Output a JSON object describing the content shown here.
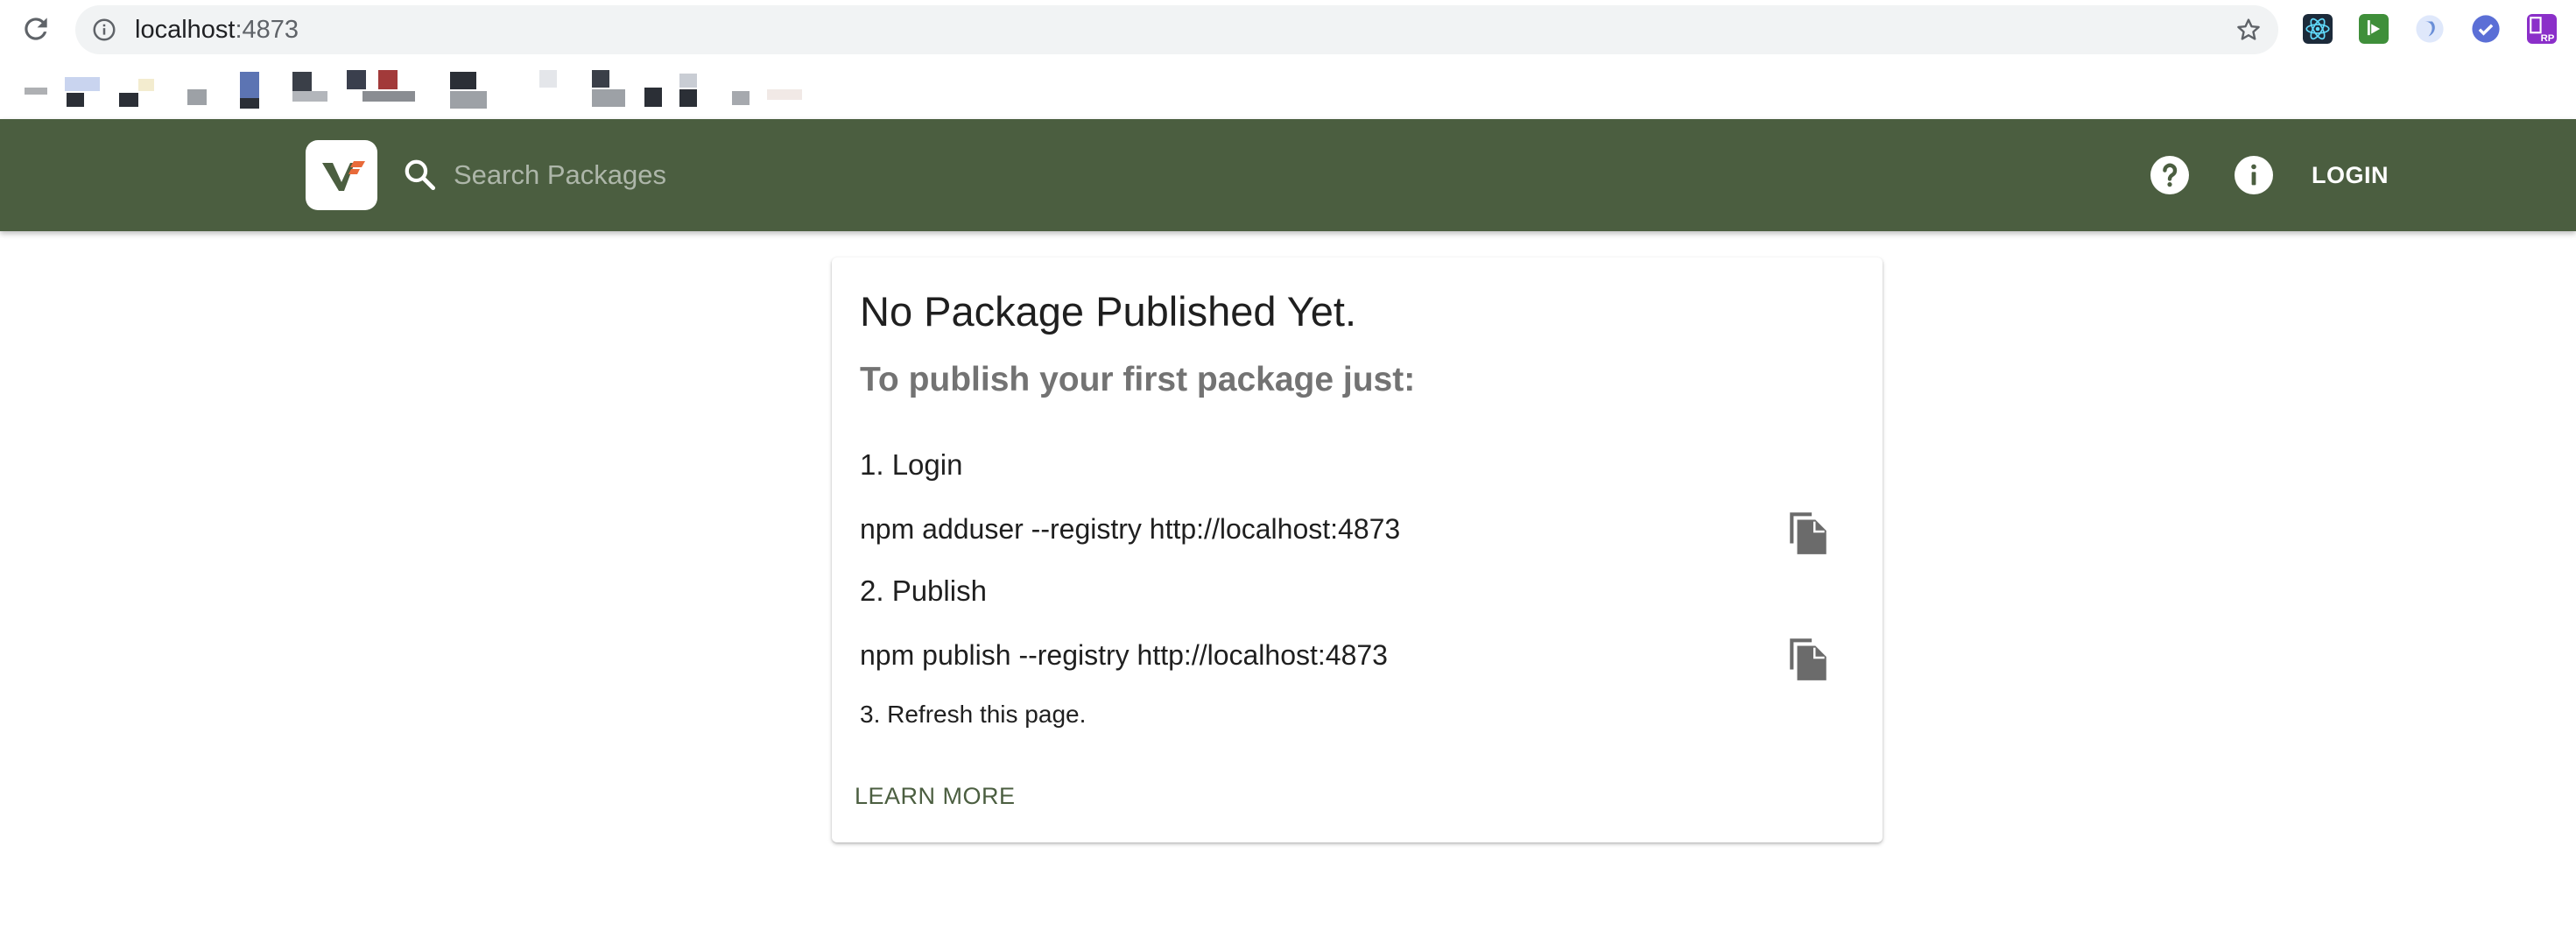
{
  "browser": {
    "url_host": "localhost",
    "url_port": ":4873",
    "extensions": [
      {
        "icon": "react-devtools-icon",
        "color": "#1c2a3a"
      },
      {
        "icon": "green-extension-icon",
        "color": "#3f8f3a"
      },
      {
        "icon": "blue-swirl-extension-icon",
        "color": "#6a8fd8"
      },
      {
        "icon": "check-extension-icon",
        "color": "#5b6fd6"
      },
      {
        "icon": "rp-extension-icon",
        "color": "#8b2fc9"
      }
    ]
  },
  "header": {
    "background": "#4b5e40",
    "search_placeholder": "Search Packages",
    "login_label": "LOGIN"
  },
  "card": {
    "title": "No Package Published Yet.",
    "subtitle": "To publish your first package just:",
    "step1": "1. Login",
    "cmd1": "npm adduser --registry http://localhost:4873",
    "step2": "2. Publish",
    "cmd2": "npm publish --registry http://localhost:4873",
    "step3": "3. Refresh this page.",
    "learn_more": "LEARN MORE"
  }
}
